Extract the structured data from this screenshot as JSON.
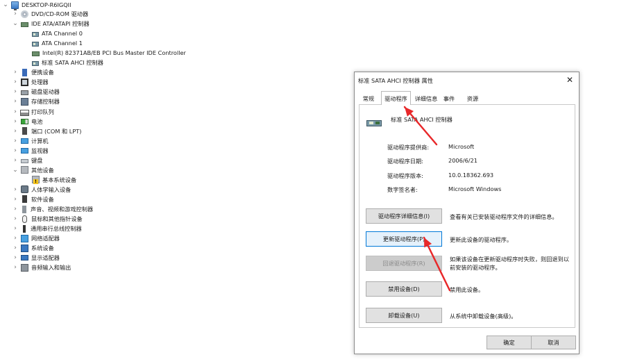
{
  "tree": {
    "root": "DESKTOP-R6IGQII",
    "items": [
      {
        "label": "DVD/CD-ROM 驱动器",
        "icon": "dvd-drive-icon",
        "state": "collapsed"
      },
      {
        "label": "IDE ATA/ATAPI 控制器",
        "icon": "ide-controller-icon",
        "state": "expanded"
      },
      {
        "label": "ATA Channel 0",
        "icon": "ata-channel-icon",
        "state": "child"
      },
      {
        "label": "ATA Channel 1",
        "icon": "ata-channel-icon",
        "state": "child"
      },
      {
        "label": "Intel(R) 82371AB/EB PCI Bus Master IDE Controller",
        "icon": "ide-controller-icon",
        "state": "child"
      },
      {
        "label": "标准 SATA AHCI 控制器",
        "icon": "sata-controller-icon",
        "state": "child"
      },
      {
        "label": "便携设备",
        "icon": "portable-device-icon",
        "state": "collapsed"
      },
      {
        "label": "处理器",
        "icon": "processor-icon",
        "state": "collapsed"
      },
      {
        "label": "磁盘驱动器",
        "icon": "disk-drive-icon",
        "state": "collapsed"
      },
      {
        "label": "存储控制器",
        "icon": "storage-controller-icon",
        "state": "collapsed"
      },
      {
        "label": "打印队列",
        "icon": "printer-icon",
        "state": "collapsed"
      },
      {
        "label": "电池",
        "icon": "battery-icon",
        "state": "collapsed"
      },
      {
        "label": "端口 (COM 和 LPT)",
        "icon": "port-icon",
        "state": "collapsed"
      },
      {
        "label": "计算机",
        "icon": "computer-icon",
        "state": "collapsed"
      },
      {
        "label": "监视器",
        "icon": "monitor-icon",
        "state": "collapsed"
      },
      {
        "label": "键盘",
        "icon": "keyboard-icon",
        "state": "collapsed"
      },
      {
        "label": "其他设备",
        "icon": "other-devices-icon",
        "state": "expanded"
      },
      {
        "label": "基本系统设备",
        "icon": "warning-device-icon",
        "state": "child"
      },
      {
        "label": "人体学输入设备",
        "icon": "hid-icon",
        "state": "collapsed"
      },
      {
        "label": "软件设备",
        "icon": "software-device-icon",
        "state": "collapsed"
      },
      {
        "label": "声音、视频和游戏控制器",
        "icon": "sound-icon",
        "state": "collapsed"
      },
      {
        "label": "鼠标和其他指针设备",
        "icon": "mouse-icon",
        "state": "collapsed"
      },
      {
        "label": "通用串行总线控制器",
        "icon": "usb-icon",
        "state": "collapsed"
      },
      {
        "label": "网络适配器",
        "icon": "network-adapter-icon",
        "state": "collapsed"
      },
      {
        "label": "系统设备",
        "icon": "system-device-icon",
        "state": "collapsed"
      },
      {
        "label": "显示适配器",
        "icon": "display-adapter-icon",
        "state": "collapsed"
      },
      {
        "label": "音频输入和输出",
        "icon": "audio-io-icon",
        "state": "collapsed"
      }
    ]
  },
  "dialog": {
    "title": "标准 SATA AHCI 控制器 属性",
    "close_glyph": "✕",
    "tabs": [
      "常规",
      "驱动程序",
      "详细信息",
      "事件",
      "资源"
    ],
    "active_tab": 1,
    "device_name": "标准 SATA AHCI 控制器",
    "properties": [
      {
        "label": "驱动程序提供商:",
        "value": "Microsoft"
      },
      {
        "label": "驱动程序日期:",
        "value": "2006/6/21"
      },
      {
        "label": "驱动程序版本:",
        "value": "10.0.18362.693"
      },
      {
        "label": "数字签名者:",
        "value": "Microsoft Windows"
      }
    ],
    "actions": [
      {
        "button": "驱动程序详细信息(I)",
        "description": "查看有关已安装驱动程序文件的详细信息。",
        "state": "normal"
      },
      {
        "button": "更新驱动程序(P)",
        "description": "更新此设备的驱动程序。",
        "state": "focused"
      },
      {
        "button": "回退驱动程序(R)",
        "description": "如果该设备在更新驱动程序时失败，则回退到以前安装的驱动程序。",
        "state": "disabled"
      },
      {
        "button": "禁用设备(D)",
        "description": "禁用此设备。",
        "state": "normal"
      },
      {
        "button": "卸载设备(U)",
        "description": "从系统中卸载设备(高级)。",
        "state": "normal"
      }
    ],
    "ok_label": "确定",
    "cancel_label": "取消"
  },
  "colors": {
    "annotation_arrow": "#e8282a",
    "focus_border": "#0078d7"
  }
}
